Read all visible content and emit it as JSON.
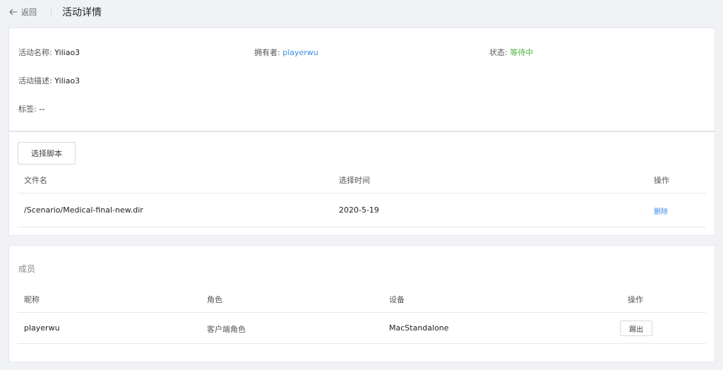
{
  "header": {
    "back_label": "返回",
    "title": "活动详情"
  },
  "info": {
    "name_label": "活动名称:",
    "name_value": "Yiliao3",
    "owner_label": "拥有者:",
    "owner_value": "playerwu",
    "status_label": "状态:",
    "status_value": "等待中",
    "desc_label": "活动描述:",
    "desc_value": "Yiliao3",
    "tags_label": "标签:",
    "tags_value": "--"
  },
  "scripts": {
    "select_button": "选择脚本",
    "columns": [
      "文件名",
      "选择时间",
      "操作"
    ],
    "rows": [
      {
        "filename": "/Scenario/Medical-final-new.dir",
        "time": "2020-5-19",
        "action": "删除"
      }
    ]
  },
  "members": {
    "title": "成员",
    "columns": [
      "昵称",
      "角色",
      "设备",
      "操作"
    ],
    "rows": [
      {
        "nickname": "playerwu",
        "role": "客户端角色",
        "device": "MacStandalone",
        "action": "踢出"
      }
    ]
  },
  "colors": {
    "link": "#3a8ee6",
    "status_green": "#52b13c",
    "background": "#f0f2f5"
  }
}
